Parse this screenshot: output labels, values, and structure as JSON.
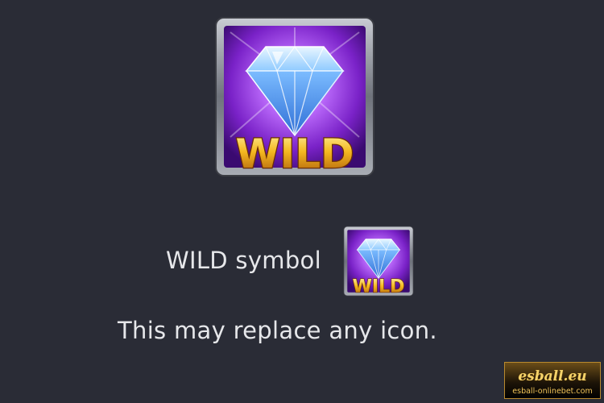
{
  "symbol_text": "WILD",
  "symbol_row": {
    "label": "WILD symbol"
  },
  "description": "This may replace any icon.",
  "watermark": {
    "brand": "esball.eu",
    "url": "esball-onlinebet.com"
  },
  "icons": {
    "main": "diamond-wild-icon",
    "small": "diamond-wild-icon"
  },
  "colors": {
    "background": "#2a2c36",
    "text": "#e6e7ea",
    "gold": "#f4b820",
    "tile_purple": "#8a2fd6",
    "diamond_blue": "#6fb8ff"
  }
}
